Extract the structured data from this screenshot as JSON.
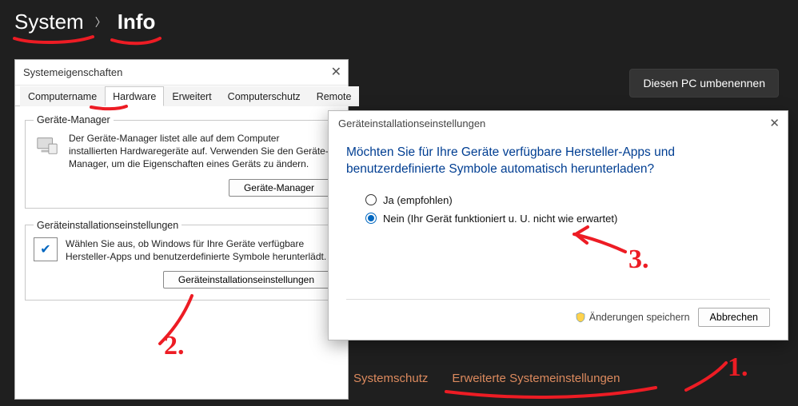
{
  "breadcrumb": {
    "root": "System",
    "page": "Info"
  },
  "rename_button": "Diesen PC umbenennen",
  "dark_links": {
    "sysprotect": "Systemschutz",
    "advanced": "Erweiterte Systemeinstellungen"
  },
  "sysprops": {
    "title": "Systemeigenschaften",
    "tabs": {
      "computername": "Computername",
      "hardware": "Hardware",
      "erweitert": "Erweitert",
      "computerschutz": "Computerschutz",
      "remote": "Remote"
    },
    "devmgr": {
      "legend": "Geräte-Manager",
      "desc": "Der Geräte-Manager listet alle auf dem Computer installierten Hardwaregeräte auf. Verwenden Sie den Geräte-Manager, um die Eigenschaften eines Geräts zu ändern.",
      "button": "Geräte-Manager"
    },
    "install": {
      "legend": "Geräteinstallationseinstellungen",
      "desc": "Wählen Sie aus, ob Windows für Ihre Geräte verfügbare Hersteller-Apps und benutzerdefinierte Symbole herunterlädt.",
      "button": "Geräteinstallationseinstellungen"
    }
  },
  "dis": {
    "title": "Geräteinstallationseinstellungen",
    "question": "Möchten Sie für Ihre Geräte verfügbare Hersteller-Apps und benutzerdefinierte Symbole automatisch herunterladen?",
    "opt_yes": "Ja (empfohlen)",
    "opt_no": "Nein (Ihr Gerät funktioniert u. U. nicht wie erwartet)",
    "save": "Änderungen speichern",
    "cancel": "Abbrechen"
  },
  "annotations": {
    "n1": "1.",
    "n2": "2.",
    "n3": "3."
  }
}
